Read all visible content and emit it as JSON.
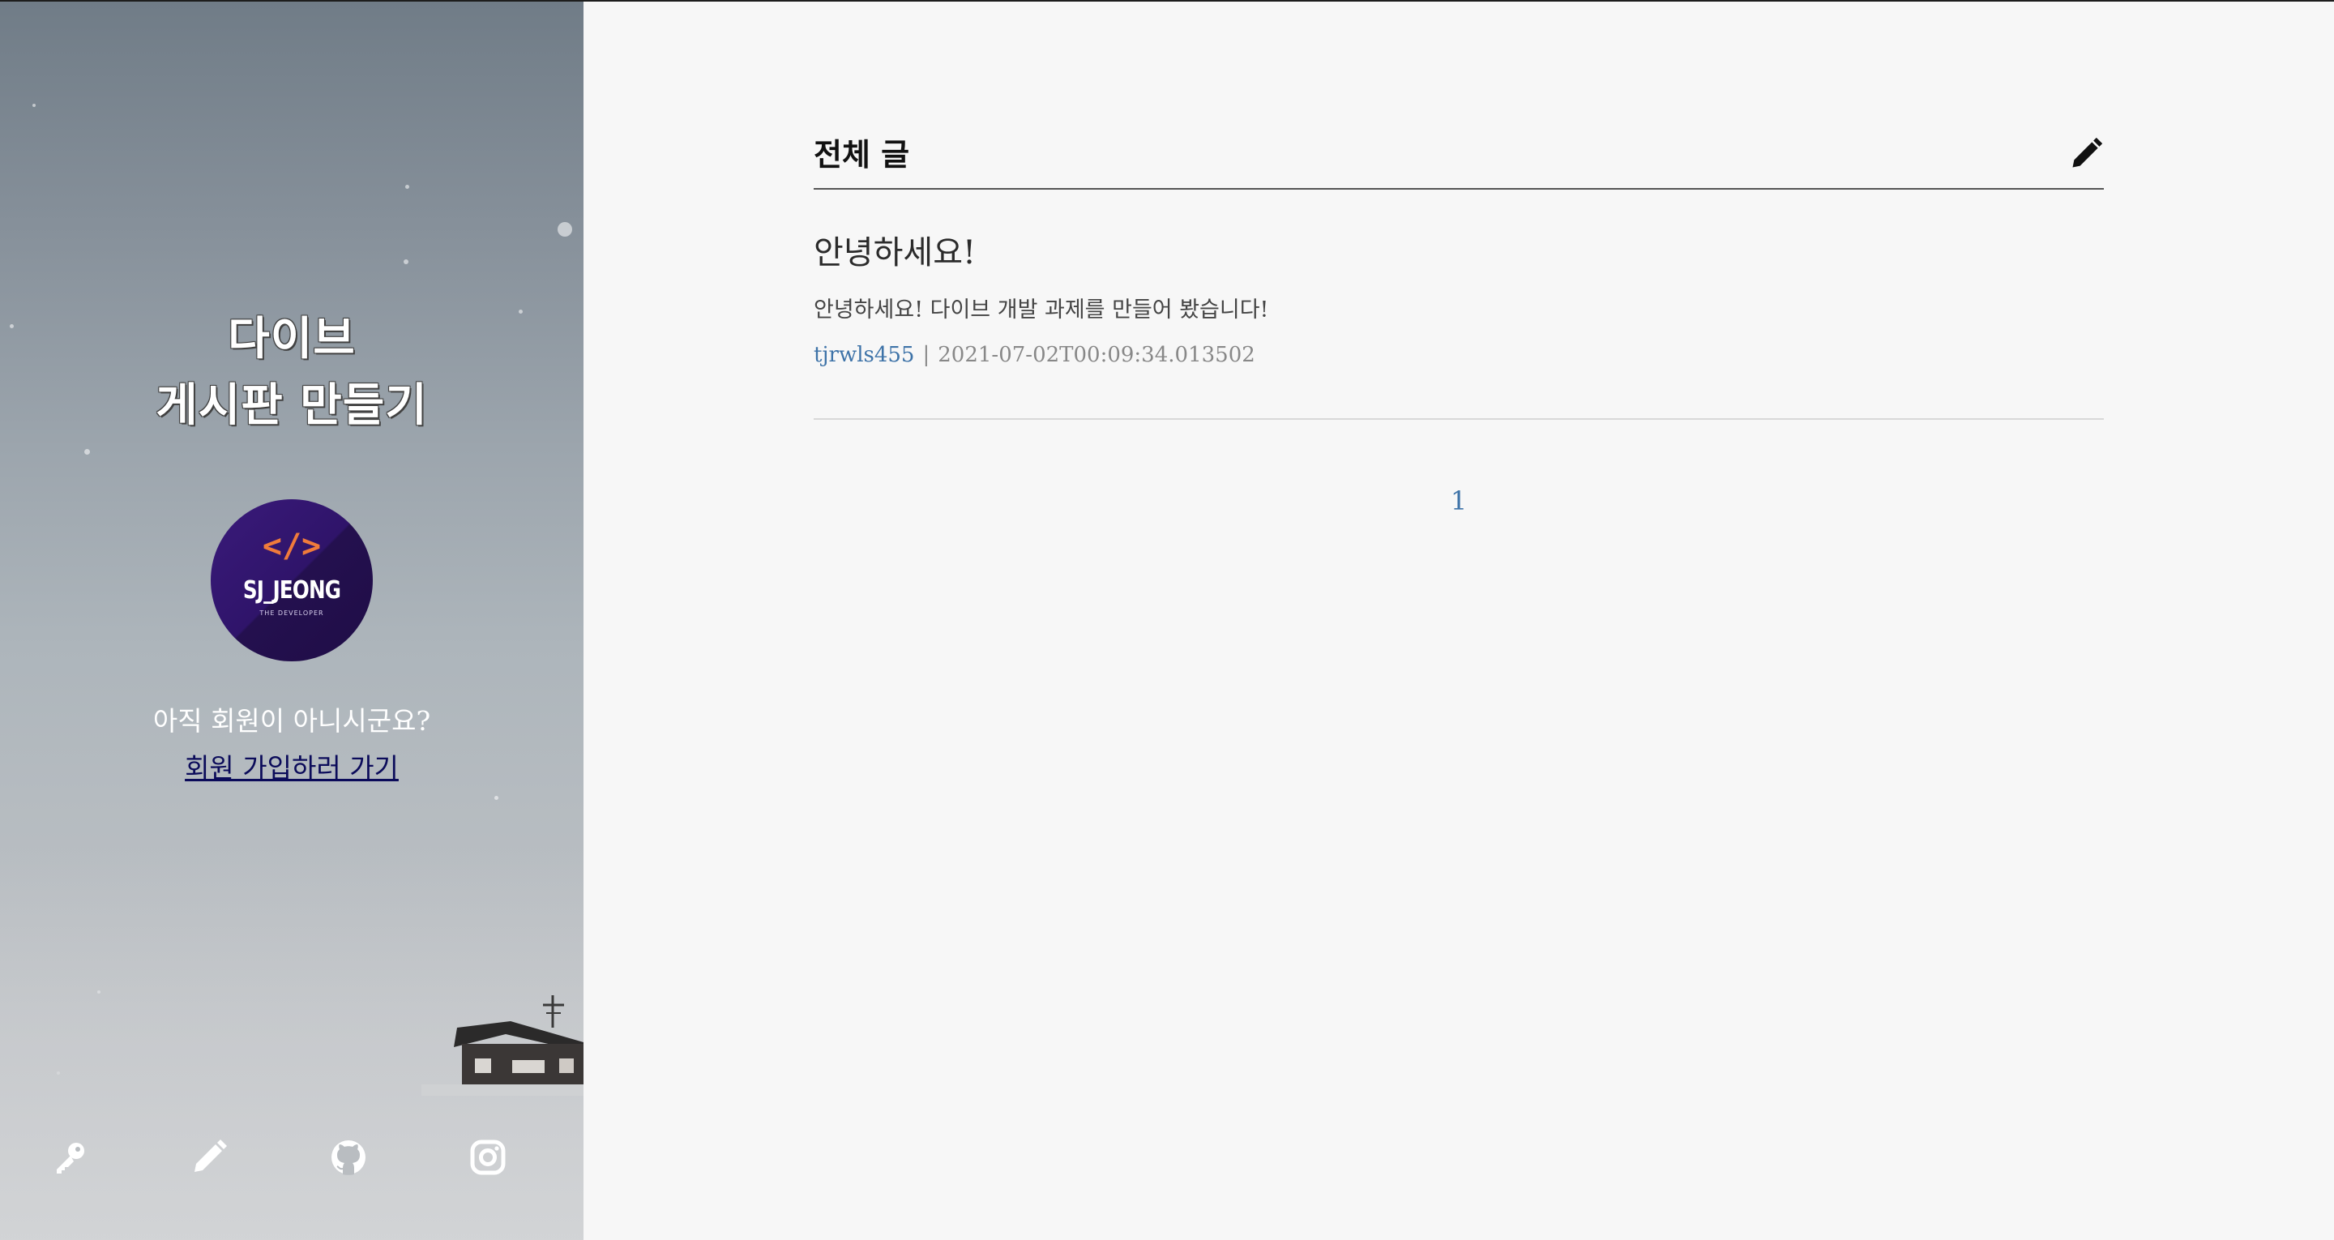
{
  "sidebar": {
    "title_line1": "다이브",
    "title_line2": "게시판 만들기",
    "avatar": {
      "symbol": "</>",
      "name": "SJ_JEONG",
      "subtitle": "THE DEVELOPER"
    },
    "signup_question": "아직 회원이 아니시군요?",
    "signup_link": "회원 가입하러 가기",
    "icons": [
      "key-icon",
      "pencil-icon",
      "github-icon",
      "instagram-icon"
    ]
  },
  "board": {
    "title": "전체 글",
    "write_icon": "pencil-icon",
    "posts": [
      {
        "title": "안녕하세요!",
        "excerpt": "안녕하세요! 다이브 개발 과제를 만들어 봤습니다!",
        "author": "tjrwls455",
        "separator": "|",
        "created_at": "2021-07-02T00:09:34.013502"
      }
    ],
    "pagination": {
      "pages": [
        "1"
      ]
    }
  },
  "colors": {
    "link_blue": "#3e73a8",
    "avatar_purple": "#2f146a",
    "avatar_accent": "#f07b3b",
    "signup_link": "#0b0b5a"
  }
}
